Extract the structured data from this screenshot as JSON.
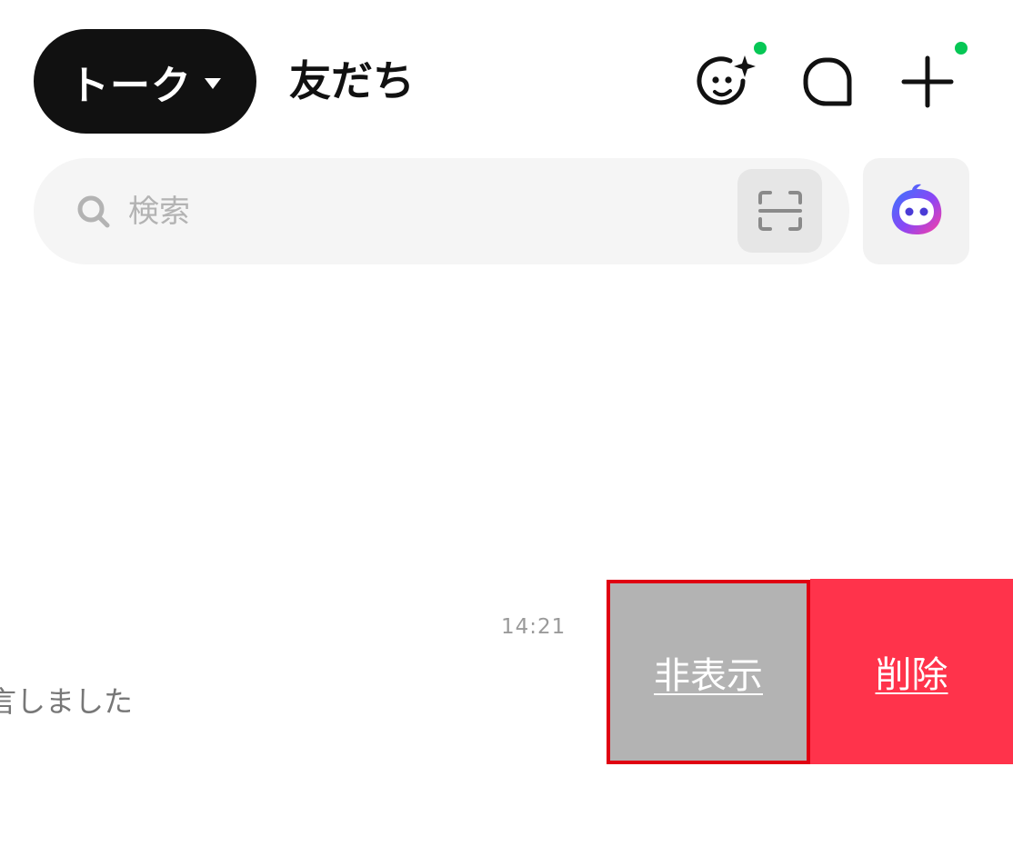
{
  "header": {
    "talk_tab_label": "トーク",
    "friends_tab_label": "友だち",
    "icons": [
      "face-sparkle-icon",
      "square-chat-icon",
      "plus-icon"
    ],
    "notification_dot_color": "#06c755"
  },
  "search": {
    "placeholder": "検索",
    "icon": "search-icon",
    "scan_icon": "scan-icon",
    "ai_icon": "ai-assistant-icon"
  },
  "chat_row": {
    "time": "14:21",
    "preview": "言しました",
    "actions": {
      "hide_label": "非表示",
      "delete_label": "削除",
      "hide_color": "#b3b3b3",
      "delete_color": "#ff334b",
      "highlight_border_color": "#e00012"
    }
  }
}
